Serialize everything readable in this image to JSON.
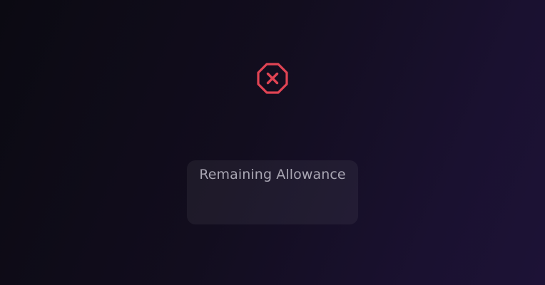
{
  "status": {
    "icon": "error-octagon-x-icon",
    "color": "#e04454"
  },
  "allowance_card": {
    "label": "Remaining Allowance",
    "value": ""
  }
}
